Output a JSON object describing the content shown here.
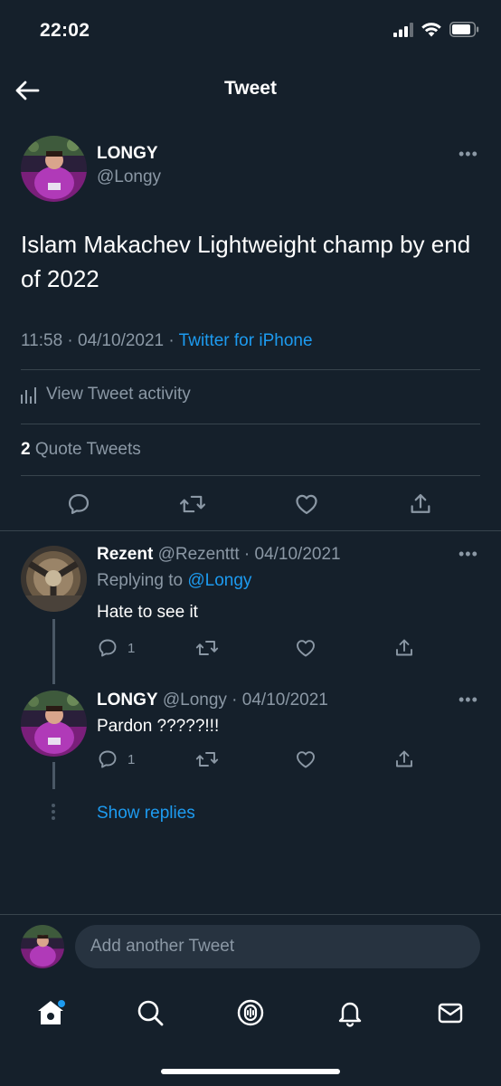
{
  "status_bar": {
    "time": "22:02"
  },
  "header": {
    "title": "Tweet"
  },
  "tweet": {
    "author_name": "LONGY",
    "author_handle": "@Longy",
    "more": "•••",
    "text": "Islam Makachev Lightweight champ by end of 2022",
    "timestamp": "11:58 · 04/10/2021 ·",
    "source": "Twitter for iPhone",
    "activity_label": "View Tweet activity",
    "quote_count": "2",
    "quote_label": "Quote Tweets"
  },
  "replies": [
    {
      "name": "Rezent",
      "meta": "@Rezenttt · 04/10/2021",
      "replying_prefix": "Replying to",
      "replying_handle": "@Longy",
      "text": "Hate to see it",
      "reply_count": "1"
    },
    {
      "name": "LONGY",
      "meta": "@Longy · 04/10/2021",
      "text": "Pardon ?????!!!",
      "reply_count": "1"
    }
  ],
  "show_replies": "Show replies",
  "composer": {
    "placeholder": "Add another Tweet"
  },
  "colors": {
    "background": "#15202b",
    "accent": "#1d9bf0",
    "secondary_text": "#8b98a5",
    "divider": "#38444d"
  },
  "icons": {
    "back": "arrow-left-icon",
    "reply": "reply-icon",
    "retweet": "retweet-icon",
    "like": "heart-icon",
    "share": "share-icon",
    "tabs": [
      "home-icon",
      "search-icon",
      "spaces-icon",
      "notifications-icon",
      "messages-icon"
    ]
  }
}
